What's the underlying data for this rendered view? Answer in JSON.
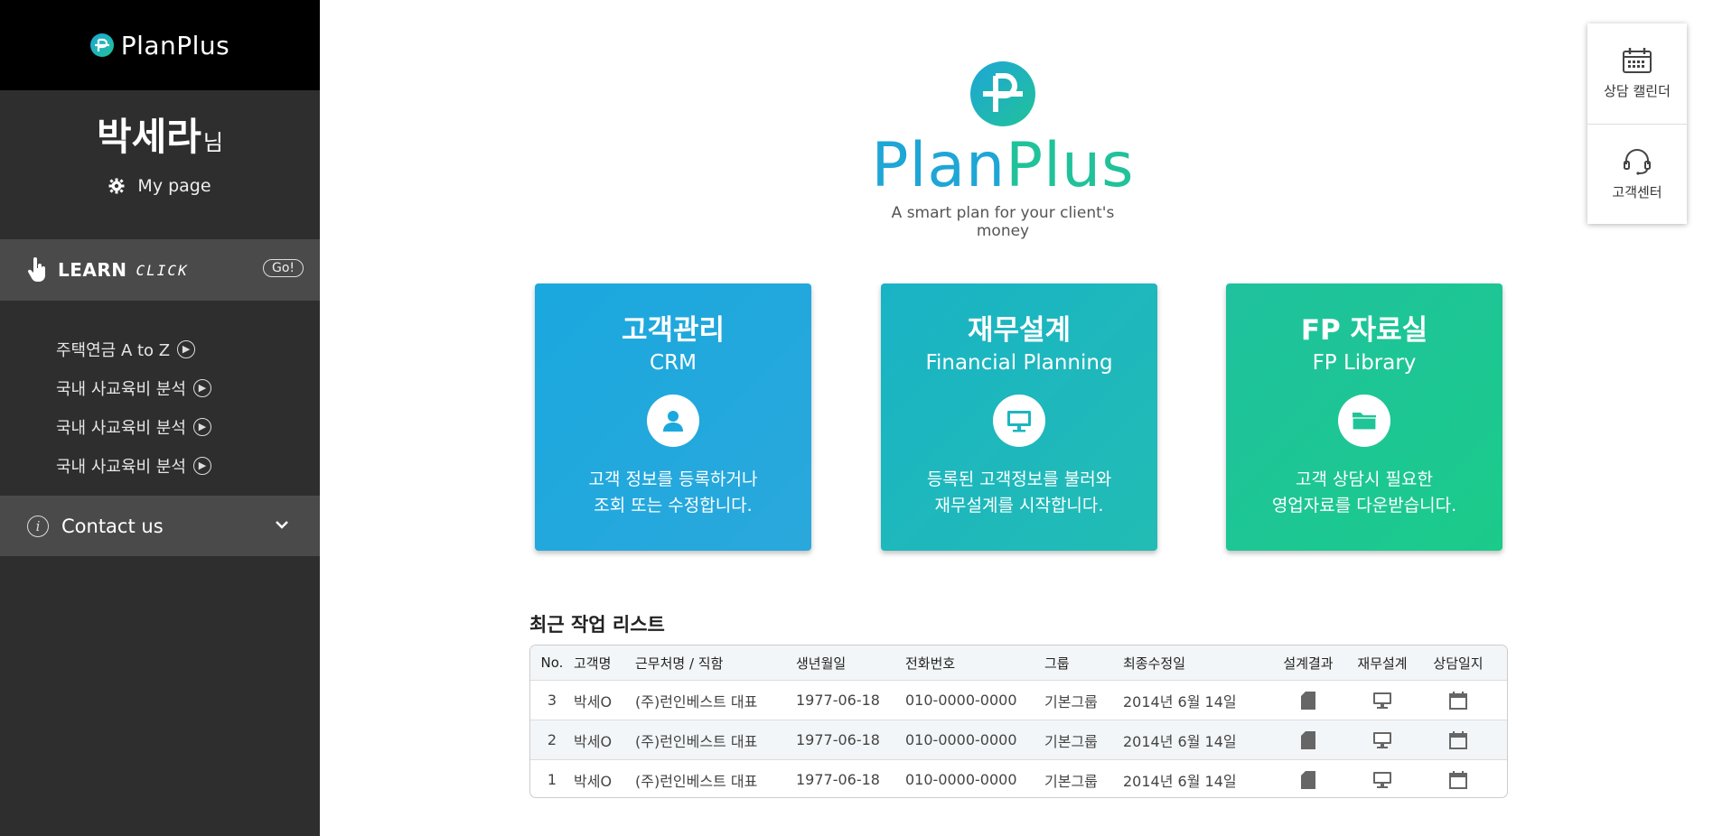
{
  "sidebar": {
    "logo": "PlanPlus",
    "user_name": "박세라",
    "user_suffix": "님",
    "mypage_label": "My page",
    "learn_label": "LEARN",
    "learn_click": "CLICK",
    "go_label": "Go!",
    "links": [
      "주택연금 A to Z",
      "국내 사교육비 분석",
      "국내 사교육비 분석",
      "국내 사교육비 분석"
    ],
    "contact_label": "Contact us"
  },
  "brand": {
    "word_part1": "Plan",
    "word_part2": "Plus",
    "tagline": "A smart plan for your client's money"
  },
  "cards": [
    {
      "title": "고객관리",
      "subtitle": "CRM",
      "desc1": "고객 정보를 등록하거나",
      "desc2": "조회 또는 수정합니다.",
      "icon": "user-icon"
    },
    {
      "title": "재무설계",
      "subtitle": "Financial Planning",
      "desc1": "등록된 고객정보를 불러와",
      "desc2": "재무설계를 시작합니다.",
      "icon": "monitor-icon"
    },
    {
      "title": "FP 자료실",
      "subtitle": "FP Library",
      "desc1": "고객 상담시 필요한",
      "desc2": "영업자료를 다운받습니다.",
      "icon": "folder-icon"
    }
  ],
  "float_panel": {
    "calendar_label": "상담 캘린더",
    "support_label": "고객센터"
  },
  "recent": {
    "title": "최근 작업 리스트",
    "headers": {
      "no": "No.",
      "name": "고객명",
      "company": "근무처명 / 직함",
      "birth": "생년월일",
      "phone": "전화번호",
      "group": "그룹",
      "modified": "최종수정일",
      "result": "설계결과",
      "plan": "재무설계",
      "log": "상담일지"
    },
    "rows": [
      {
        "no": "3",
        "name": "박세O",
        "company": "(주)런인베스트 대표",
        "birth": "1977-06-18",
        "phone": "010-0000-0000",
        "group": "기본그룹",
        "modified": "2014년 6월 14일"
      },
      {
        "no": "2",
        "name": "박세O",
        "company": "(주)런인베스트 대표",
        "birth": "1977-06-18",
        "phone": "010-0000-0000",
        "group": "기본그룹",
        "modified": "2014년 6월 14일"
      },
      {
        "no": "1",
        "name": "박세O",
        "company": "(주)런인베스트 대표",
        "birth": "1977-06-18",
        "phone": "010-0000-0000",
        "group": "기본그룹",
        "modified": "2014년 6월 14일"
      }
    ]
  },
  "colors": {
    "accent_blue": "#1ea6d6",
    "accent_green": "#21c29a",
    "sidebar_bg": "#2e2e2e"
  }
}
